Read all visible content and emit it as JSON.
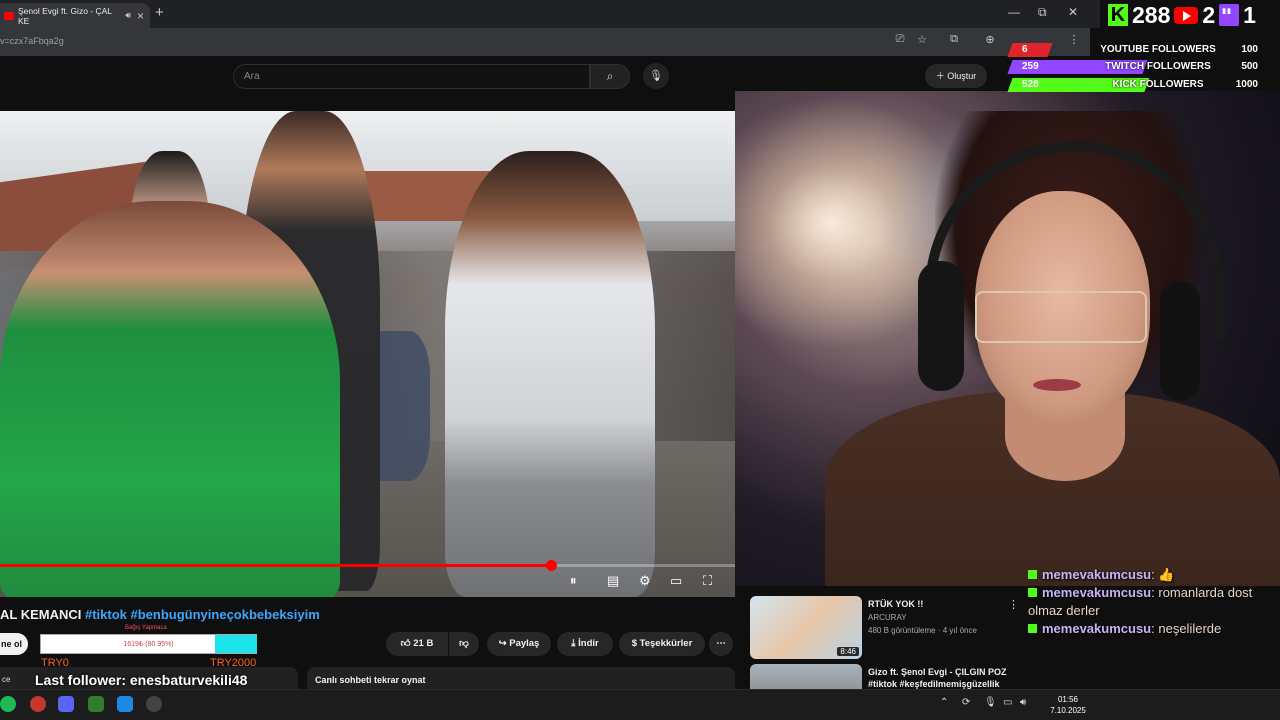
{
  "browser": {
    "tab_title": "Şenol Evgi ft. Gizo - ÇAL KE",
    "new_tab_symbol": "+",
    "url": "v=czx7aFbqa2g",
    "win_controls": [
      "—",
      "⧉",
      "✕"
    ]
  },
  "youtube": {
    "search_placeholder": "Ara",
    "create_label": "Oluştur",
    "video_progress_fraction": 0.75,
    "video_title_prefix": "AL KEMANCI",
    "video_title_tags": "#tiktok #benbugünyineçokbebeksiyim",
    "subscribe_label": "ne ol",
    "like_count": "21 B",
    "share_label": "Paylaş",
    "download_label": "İndir",
    "thanks_label": "Teşekkürler",
    "chat_replay_label": "Canlı sohbeti tekrar oynat",
    "left_card_text": "ce"
  },
  "donation": {
    "label": "Bağış Yapmaca",
    "progress_text": "1619₺ (80.95%)",
    "progress_fraction": 0.8095,
    "start_label": "TRY0",
    "goal_label": "TRY2000"
  },
  "last_follower": "Last follower: enesbaturvekili48",
  "follower_counts": {
    "kick": "288",
    "youtube": "2",
    "twitch": "1"
  },
  "goals": [
    {
      "current": "6",
      "name": "YOUTUBE FOLLOWERS",
      "max": "100",
      "color": "#e0242c",
      "fraction": 0.06
    },
    {
      "current": "259",
      "name": "TWITCH FOLLOWERS",
      "max": "500",
      "color": "#9146ff",
      "fraction": 0.518
    },
    {
      "current": "528",
      "name": "KICK FOLLOWERS",
      "max": "1000",
      "color": "#53fc18",
      "fraction": 0.528
    }
  ],
  "recommended": [
    {
      "title": "RTÜK YOK !!",
      "channel": "ARCURAY",
      "meta": "480 B görüntüleme · 4 yıl önce",
      "duration": "8:46"
    },
    {
      "title": "Gizo ft. Şenol Evgi - ÇILGIN POZ #tiktok #keşfedilmemişgüzellik",
      "channel": "",
      "meta": "",
      "duration": ""
    }
  ],
  "chat": [
    {
      "user": "memevakumcusu",
      "message": "👍"
    },
    {
      "user": "memevakumcusu",
      "message": "romanlarda dost olmaz derler"
    },
    {
      "user": "memevakumcusu",
      "message": "neşelilerde"
    }
  ],
  "taskbar": {
    "time": "01:56",
    "date": "7.10.2025"
  },
  "colors": {
    "accent": "#ff0000",
    "kick": "#53fc18",
    "twitch": "#9146ff",
    "link": "#3ea6ff"
  }
}
